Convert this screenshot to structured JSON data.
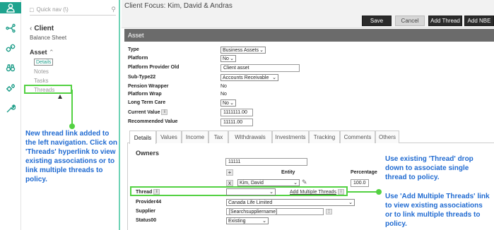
{
  "rail": {
    "items": [
      "user-icon",
      "network-icon",
      "link-icon",
      "binoculars-icon",
      "gears-icon",
      "wrench-icon"
    ]
  },
  "nav": {
    "search_placeholder": "Quick nav (\\)",
    "back_label": "Client",
    "back_sub": "Balance Sheet",
    "section_label": "Asset",
    "items": [
      "Details",
      "Notes",
      "Tasks",
      "Threads"
    ],
    "selected_index": 0
  },
  "annotations": {
    "left": "New thread link added to the left navigation. Click on 'Threads' hyperlink to view existing associations or to link multiple threads to policy.",
    "right_top": "Use existing 'Thread' drop down to associate single thread to policy.",
    "right_bottom": "Use 'Add Multiple Threads' link to view existing associations or to link multiple threads to policy.",
    "color": "#1f6ad1",
    "highlight_color": "#53d142"
  },
  "header": {
    "title": "Client Focus: Kim, David & Andras",
    "buttons": {
      "save": "Save",
      "cancel": "Cancel",
      "add_thread": "Add Thread",
      "add_nbe": "Add NBE"
    }
  },
  "asset": {
    "bar_title": "Asset",
    "fields": {
      "type": {
        "label": "Type",
        "value": "Business Assets"
      },
      "platform": {
        "label": "Platform",
        "value": "No"
      },
      "platform_provider_old": {
        "label": "Platform Provider Old",
        "value": "Client asset"
      },
      "sub_type22": {
        "label": "Sub-Type22",
        "value": "Accounts Receivable"
      },
      "pension_wrapper": {
        "label": "Pension Wrapper",
        "value": "No"
      },
      "platform_wrap": {
        "label": "Platform Wrap",
        "value": "No"
      },
      "long_term_care": {
        "label": "Long Term Care",
        "value": "No"
      },
      "current_value": {
        "label": "Current Value",
        "value": "1111111.00"
      },
      "recommended_value": {
        "label": "Recommended Value",
        "value": "11111.00"
      }
    }
  },
  "tabs": [
    "Details",
    "Values",
    "Income",
    "Tax",
    "Withdrawals",
    "Investments",
    "Tracking",
    "Comments",
    "Others"
  ],
  "active_tab": 0,
  "details": {
    "owners_label": "Owners",
    "owners_input": "11111",
    "entity_header": "Entity",
    "percentage_header": "Percentage",
    "owner_name": "Kim, David",
    "owner_percentage": "100.0",
    "thread_label": "Thread",
    "add_multiple_threads": "Add Multiple Threads",
    "provider_label": "Provider44",
    "provider_value": "Canada Life Limited",
    "supplier_label": "Supplier",
    "supplier_value": "[Searchsuppliername]",
    "status_label": "Status00",
    "status_value": "Existing"
  }
}
